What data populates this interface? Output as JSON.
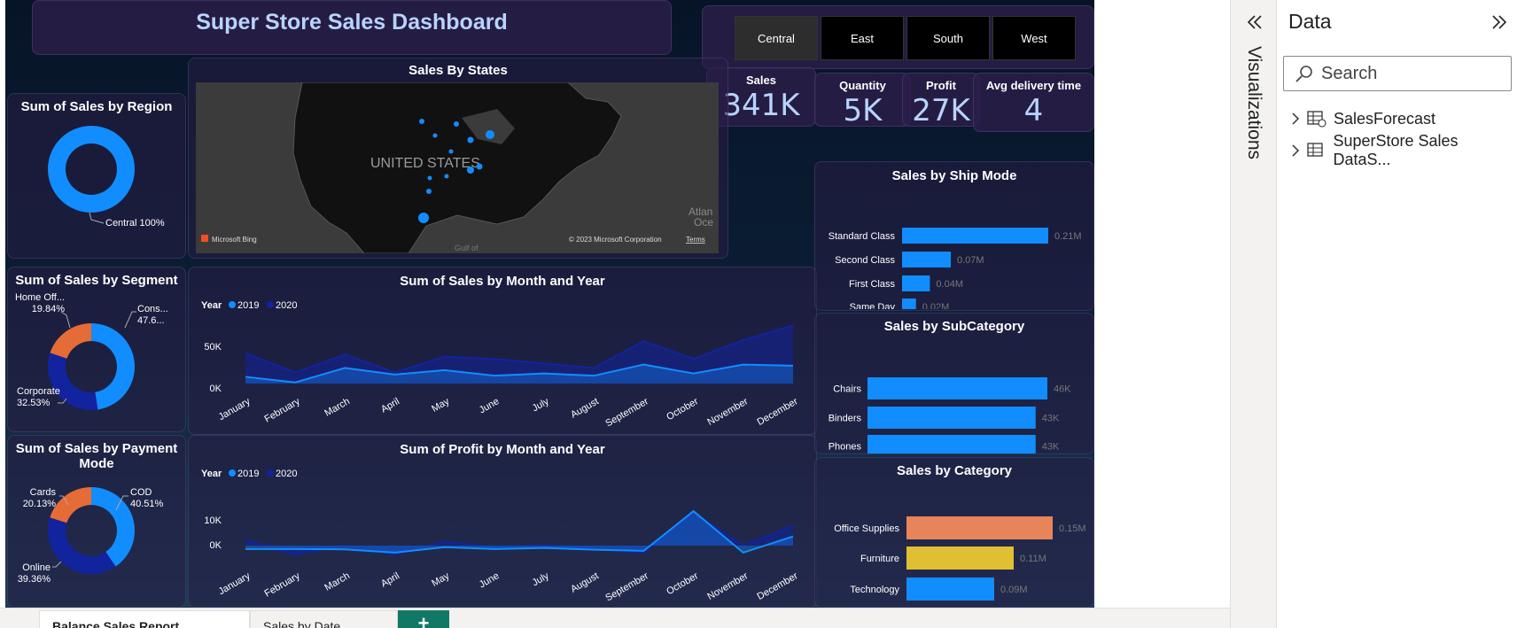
{
  "dashboard": {
    "title": "Super Store Sales Dashboard",
    "regions": [
      "Central",
      "East",
      "South",
      "West"
    ],
    "selected_region": "Central"
  },
  "kpis": [
    {
      "label": "Sales",
      "value": "341K"
    },
    {
      "label": "Quantity",
      "value": "5K"
    },
    {
      "label": "Profit",
      "value": "27K"
    },
    {
      "label": "Avg delivery time",
      "value": "4"
    }
  ],
  "colors": {
    "primary": "#118dff",
    "dark": "#12239e",
    "orange": "#e66c37",
    "salmon": "#e8845a",
    "yellow": "#e0bf33"
  },
  "map": {
    "title": "Sales By States",
    "country_label": "UNITED STATES",
    "provider": "Microsoft Bing",
    "copyright": "© 2023 Microsoft Corporation",
    "terms": "Terms",
    "ocean_label_1": "Atlan",
    "ocean_label_2": "Oce",
    "gulf_label": "Gulf of"
  },
  "chart_data": [
    {
      "type": "pie",
      "title": "Sum of Sales by Region",
      "slices": [
        {
          "label": "Central",
          "value": 100,
          "display": "Central 100%"
        }
      ]
    },
    {
      "type": "pie",
      "title": "Sum of Sales by Segment",
      "slices": [
        {
          "label": "Cons...",
          "value": 47.6,
          "display": "47.6..."
        },
        {
          "label": "Corporate",
          "value": 32.53,
          "display": "32.53%"
        },
        {
          "label": "Home Off...",
          "value": 19.84,
          "display": "19.84%"
        }
      ]
    },
    {
      "type": "pie",
      "title": "Sum of Sales by Payment Mode",
      "slices": [
        {
          "label": "COD",
          "value": 40.51,
          "display": "40.51%"
        },
        {
          "label": "Online",
          "value": 39.36,
          "display": "39.36%"
        },
        {
          "label": "Cards",
          "value": 20.13,
          "display": "20.13%"
        }
      ]
    },
    {
      "type": "area",
      "title": "Sum of Sales by Month and Year",
      "legend_title": "Year",
      "categories": [
        "January",
        "February",
        "March",
        "April",
        "May",
        "June",
        "July",
        "August",
        "September",
        "October",
        "November",
        "December"
      ],
      "series": [
        {
          "name": "2019",
          "values": [
            6000,
            1000,
            14000,
            8000,
            12000,
            7000,
            9000,
            7000,
            17000,
            9000,
            17000,
            16000
          ]
        },
        {
          "name": "2020",
          "values": [
            27000,
            10000,
            26000,
            10000,
            24000,
            22000,
            18000,
            14000,
            38000,
            22000,
            39000,
            52000
          ]
        }
      ],
      "yticks": [
        "50K",
        "0K"
      ],
      "ylim": [
        0,
        50000
      ]
    },
    {
      "type": "area",
      "title": "Sum of Profit by Month and Year",
      "legend_title": "Year",
      "categories": [
        "January",
        "February",
        "March",
        "April",
        "May",
        "June",
        "July",
        "August",
        "September",
        "October",
        "November",
        "December"
      ],
      "series": [
        {
          "name": "2019",
          "values": [
            500,
            500,
            400,
            -500,
            1000,
            500,
            800,
            300,
            0,
            11000,
            -500,
            4000
          ]
        },
        {
          "name": "2020",
          "values": [
            3000,
            -1000,
            1500,
            -1000,
            2500,
            1000,
            1500,
            500,
            -500,
            10500,
            1500,
            7000
          ]
        }
      ],
      "yticks": [
        "10K",
        "0K"
      ],
      "ylim": [
        -2000,
        12000
      ]
    },
    {
      "type": "bar",
      "title": "Sales by Ship Mode",
      "categories": [
        "Standard Class",
        "Second Class",
        "First Class",
        "Same Day"
      ],
      "values": [
        0.21,
        0.07,
        0.04,
        0.02
      ],
      "labels": [
        "0.21M",
        "0.07M",
        "0.04M",
        "0.02M"
      ],
      "max": 0.21
    },
    {
      "type": "bar",
      "title": "Sales by SubCategory",
      "categories": [
        "Chairs",
        "Binders",
        "Phones"
      ],
      "values": [
        46,
        43,
        43
      ],
      "labels": [
        "46K",
        "43K",
        "43K"
      ],
      "max": 46
    },
    {
      "type": "bar",
      "title": "Sales by Category",
      "categories": [
        "Office Supplies",
        "Furniture",
        "Technology"
      ],
      "values": [
        0.15,
        0.11,
        0.09
      ],
      "labels": [
        "0.15M",
        "0.11M",
        "0.09M"
      ],
      "max": 0.15
    }
  ],
  "panes": {
    "visualizations_label": "Visualizations",
    "data_label": "Data",
    "search_placeholder": "Search",
    "tables": [
      "SalesForecast",
      "SuperStore Sales DataS..."
    ]
  },
  "tabs": [
    "Balance Sales Report",
    "Sales by Date"
  ],
  "add_tab": "+"
}
